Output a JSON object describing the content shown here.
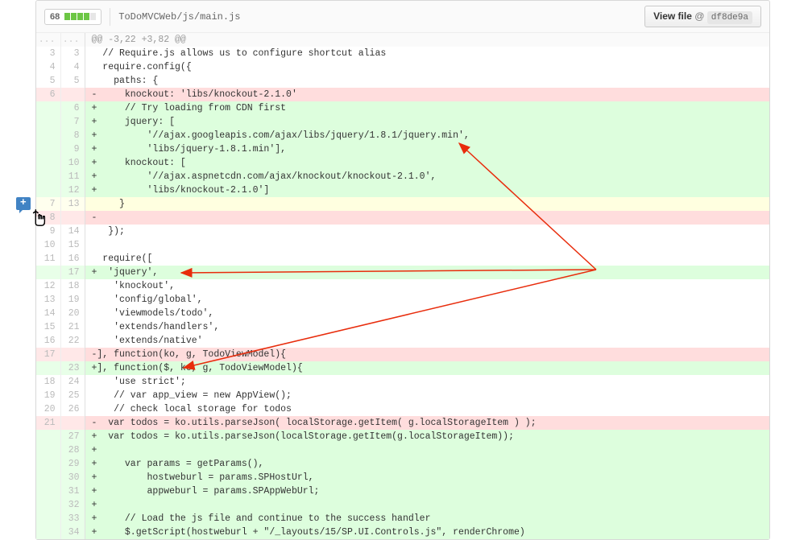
{
  "header": {
    "score": "68",
    "file_path": "ToDoMVCWeb/js/main.js",
    "view_label": "View file",
    "view_at": "@",
    "commit": "df8de9a"
  },
  "diff": {
    "hunk": "@@ -3,22 +3,82 @@",
    "lines": [
      {
        "o": "3",
        "n": "3",
        "t": "ctx",
        "c": "  // Require.js allows us to configure shortcut alias"
      },
      {
        "o": "4",
        "n": "4",
        "t": "ctx",
        "c": "  require.config({"
      },
      {
        "o": "5",
        "n": "5",
        "t": "ctx",
        "c": "    paths: {"
      },
      {
        "o": "6",
        "n": "",
        "t": "del",
        "c": "-     knockout: 'libs/knockout-2.1.0'"
      },
      {
        "o": "",
        "n": "6",
        "t": "add",
        "c": "+     // Try loading from CDN first"
      },
      {
        "o": "",
        "n": "7",
        "t": "add",
        "c": "+     jquery: ["
      },
      {
        "o": "",
        "n": "8",
        "t": "add",
        "c": "+         '//ajax.googleapis.com/ajax/libs/jquery/1.8.1/jquery.min',"
      },
      {
        "o": "",
        "n": "9",
        "t": "add",
        "c": "+         'libs/jquery-1.8.1.min'],"
      },
      {
        "o": "",
        "n": "10",
        "t": "add",
        "c": "+     knockout: ["
      },
      {
        "o": "",
        "n": "11",
        "t": "add",
        "c": "+         '//ajax.aspnetcdn.com/ajax/knockout/knockout-2.1.0',"
      },
      {
        "o": "",
        "n": "12",
        "t": "add",
        "c": "+         'libs/knockout-2.1.0']"
      },
      {
        "o": "7",
        "n": "13",
        "t": "chg",
        "c": "     }"
      },
      {
        "o": "8",
        "n": "",
        "t": "del",
        "c": "-"
      },
      {
        "o": "9",
        "n": "14",
        "t": "ctx",
        "c": "   });"
      },
      {
        "o": "10",
        "n": "15",
        "t": "ctx",
        "c": " "
      },
      {
        "o": "11",
        "n": "16",
        "t": "ctx",
        "c": "  require(["
      },
      {
        "o": "",
        "n": "17",
        "t": "add",
        "c": "+  'jquery',"
      },
      {
        "o": "12",
        "n": "18",
        "t": "ctx",
        "c": "    'knockout',"
      },
      {
        "o": "13",
        "n": "19",
        "t": "ctx",
        "c": "    'config/global',"
      },
      {
        "o": "14",
        "n": "20",
        "t": "ctx",
        "c": "    'viewmodels/todo',"
      },
      {
        "o": "15",
        "n": "21",
        "t": "ctx",
        "c": "    'extends/handlers',"
      },
      {
        "o": "16",
        "n": "22",
        "t": "ctx",
        "c": "    'extends/native'"
      },
      {
        "o": "17",
        "n": "",
        "t": "del",
        "c": "-], function(ko, g, TodoViewModel){"
      },
      {
        "o": "",
        "n": "23",
        "t": "add",
        "c": "+], function($, ko, g, TodoViewModel){"
      },
      {
        "o": "18",
        "n": "24",
        "t": "ctx",
        "c": "    'use strict';"
      },
      {
        "o": "19",
        "n": "25",
        "t": "ctx",
        "c": "    // var app_view = new AppView();"
      },
      {
        "o": "20",
        "n": "26",
        "t": "ctx",
        "c": "    // check local storage for todos"
      },
      {
        "o": "21",
        "n": "",
        "t": "del",
        "c": "-  var todos = ko.utils.parseJson( localStorage.getItem( g.localStorageItem ) );"
      },
      {
        "o": "",
        "n": "27",
        "t": "add",
        "c": "+  var todos = ko.utils.parseJson(localStorage.getItem(g.localStorageItem));"
      },
      {
        "o": "",
        "n": "28",
        "t": "add",
        "c": "+"
      },
      {
        "o": "",
        "n": "29",
        "t": "add",
        "c": "+     var params = getParams(),"
      },
      {
        "o": "",
        "n": "30",
        "t": "add",
        "c": "+         hostweburl = params.SPHostUrl,"
      },
      {
        "o": "",
        "n": "31",
        "t": "add",
        "c": "+         appweburl = params.SPAppWebUrl;"
      },
      {
        "o": "",
        "n": "32",
        "t": "add",
        "c": "+"
      },
      {
        "o": "",
        "n": "33",
        "t": "add",
        "c": "+     // Load the js file and continue to the success handler"
      },
      {
        "o": "",
        "n": "34",
        "t": "add",
        "c": "+     $.getScript(hostweburl + \"/_layouts/15/SP.UI.Controls.js\", renderChrome)"
      }
    ]
  }
}
